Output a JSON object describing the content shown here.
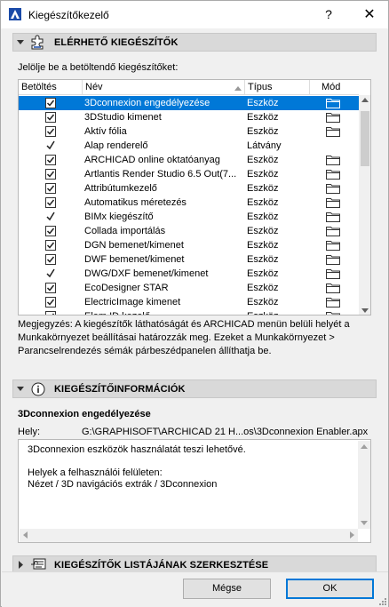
{
  "window": {
    "title": "Kiegészítőkezelő",
    "help_label": "?",
    "close_label": "✕"
  },
  "available": {
    "header": "ELÉRHETŐ KIEGÉSZÍTŐK",
    "intro": "Jelölje be a betöltendő kiegészítőket:",
    "columns": {
      "load": "Betöltés",
      "name": "Név",
      "type": "Típus",
      "mode": "Mód"
    },
    "rows": [
      {
        "state": "checked",
        "name": "3Dconnexion engedélyezése",
        "type": "Eszköz",
        "folder": true,
        "selected": true
      },
      {
        "state": "checked",
        "name": "3DStudio kimenet",
        "type": "Eszköz",
        "folder": true
      },
      {
        "state": "checked",
        "name": "Aktív fólia",
        "type": "Eszköz",
        "folder": true
      },
      {
        "state": "tick",
        "name": "Alap renderelő",
        "type": "Látvány",
        "folder": false
      },
      {
        "state": "checked",
        "name": "ARCHICAD online oktatóanyag",
        "type": "Eszköz",
        "folder": true
      },
      {
        "state": "checked",
        "name": "Artlantis Render Studio 6.5 Out(7...",
        "type": "Eszköz",
        "folder": true
      },
      {
        "state": "checked",
        "name": "Attribútumkezelő",
        "type": "Eszköz",
        "folder": true
      },
      {
        "state": "checked",
        "name": "Automatikus méretezés",
        "type": "Eszköz",
        "folder": true
      },
      {
        "state": "tick",
        "name": "BIMx kiegészítő",
        "type": "Eszköz",
        "folder": true
      },
      {
        "state": "checked",
        "name": "Collada importálás",
        "type": "Eszköz",
        "folder": true
      },
      {
        "state": "checked",
        "name": "DGN bemenet/kimenet",
        "type": "Eszköz",
        "folder": true
      },
      {
        "state": "checked",
        "name": "DWF bemenet/kimenet",
        "type": "Eszköz",
        "folder": true
      },
      {
        "state": "tick",
        "name": "DWG/DXF bemenet/kimenet",
        "type": "Eszköz",
        "folder": true
      },
      {
        "state": "checked",
        "name": "EcoDesigner STAR",
        "type": "Eszköz",
        "folder": true
      },
      {
        "state": "checked",
        "name": "ElectricImage kimenet",
        "type": "Eszköz",
        "folder": true
      },
      {
        "state": "checked",
        "name": "Elem ID kezelő",
        "type": "Eszköz",
        "folder": true
      }
    ],
    "note": "Megjegyzés: A kiegészítők láthatóságát és ARCHICAD menün belüli helyét a Munkakörnyezet beállításai határozzák meg. Ezeket a Munkakörnyezet > Parancselrendezés sémák párbeszédpanelen állíthatja be."
  },
  "info": {
    "header": "KIEGÉSZÍTŐINFORMÁCIÓK",
    "addon_title": "3Dconnexion engedélyezése",
    "location_label": "Hely:",
    "location_value": "G:\\GRAPHISOFT\\ARCHICAD 21 H...os\\3Dconnexion Enabler.apx",
    "description_lines": [
      "3Dconnexion eszközök használatát teszi lehetővé.",
      "",
      "Helyek a felhasználói felületen:",
      "Nézet / 3D navigációs extrák / 3Dconnexion"
    ]
  },
  "edit_list": {
    "header": "KIEGÉSZÍTŐK LISTÁJÁNAK SZERKESZTÉSE"
  },
  "buttons": {
    "cancel": "Mégse",
    "ok": "OK"
  },
  "colors": {
    "selection": "#0078d7",
    "section_header": "#d9d9d9"
  },
  "icons": {
    "app": "archicad-logo-icon",
    "puzzle": "puzzle-icon",
    "info": "info-icon",
    "list_edit": "list-edit-icon",
    "folder": "folder-icon"
  }
}
